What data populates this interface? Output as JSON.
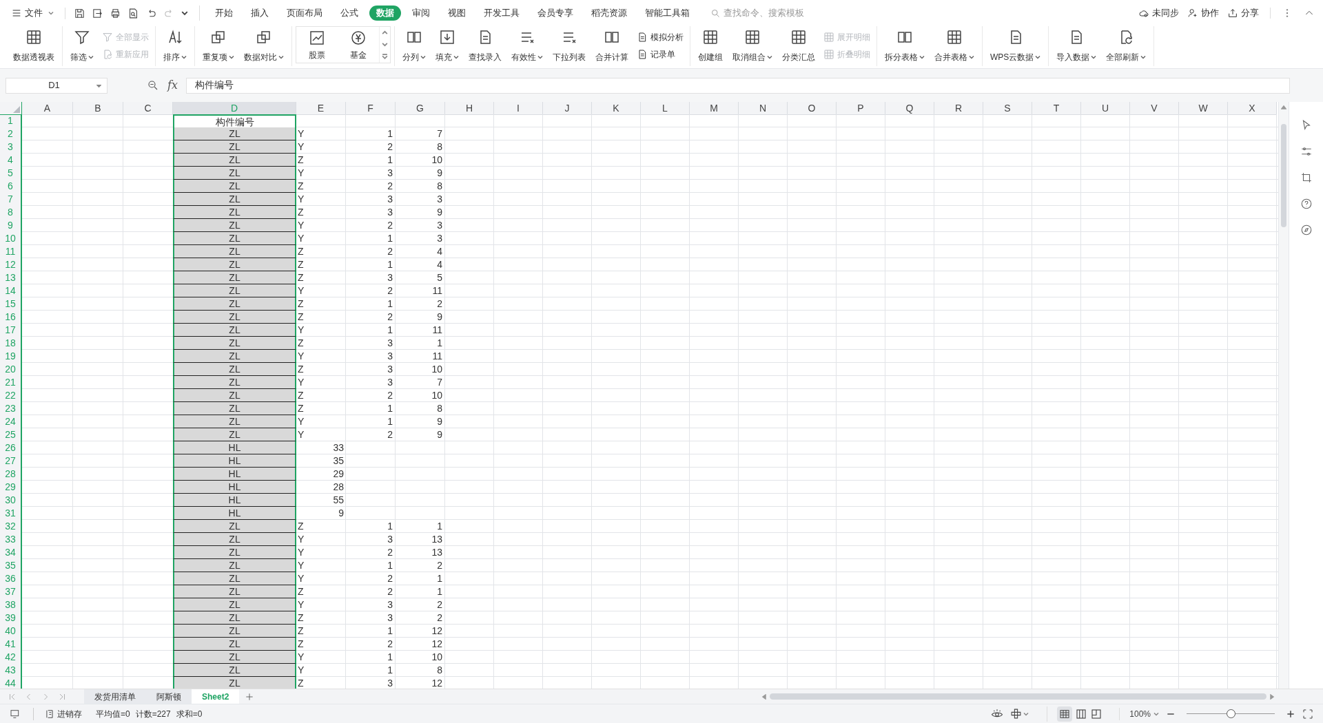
{
  "menu": {
    "label": "文件"
  },
  "tabs": [
    {
      "label": "开始",
      "selected": false
    },
    {
      "label": "插入",
      "selected": false
    },
    {
      "label": "页面布局",
      "selected": false
    },
    {
      "label": "公式",
      "selected": false
    },
    {
      "label": "数据",
      "selected": true
    },
    {
      "label": "审阅",
      "selected": false
    },
    {
      "label": "视图",
      "selected": false
    },
    {
      "label": "开发工具",
      "selected": false
    },
    {
      "label": "会员专享",
      "selected": false
    },
    {
      "label": "稻壳资源",
      "selected": false
    },
    {
      "label": "智能工具箱",
      "selected": false
    }
  ],
  "search": {
    "placeholder": "查找命令、搜索模板"
  },
  "top_actions": [
    "未同步",
    "协作",
    "分享"
  ],
  "ribbon": [
    [
      {
        "kind": "large",
        "label": "数据透视表",
        "dropdown": false,
        "disabled": false
      }
    ],
    [
      {
        "kind": "large",
        "label": "筛选",
        "dropdown": true,
        "disabled": false
      },
      {
        "kind": "stack",
        "items": [
          {
            "label": "全部显示",
            "disabled": true
          },
          {
            "label": "重新应用",
            "disabled": true
          }
        ]
      }
    ],
    [
      {
        "kind": "large",
        "label": "排序",
        "dropdown": true,
        "disabled": false
      }
    ],
    [
      {
        "kind": "large",
        "label": "重复项",
        "dropdown": true,
        "disabled": false
      },
      {
        "kind": "large",
        "label": "数据对比",
        "dropdown": true,
        "disabled": false
      }
    ],
    [
      {
        "kind": "gallery",
        "items": [
          {
            "label": "股票"
          },
          {
            "label": "基金"
          }
        ]
      }
    ],
    [
      {
        "kind": "large",
        "label": "分列",
        "dropdown": true,
        "disabled": false
      },
      {
        "kind": "large",
        "label": "填充",
        "dropdown": true,
        "disabled": false
      },
      {
        "kind": "large",
        "label": "查找录入",
        "dropdown": false,
        "disabled": false
      },
      {
        "kind": "large",
        "label": "有效性",
        "dropdown": true,
        "disabled": false
      },
      {
        "kind": "large",
        "label": "下拉列表",
        "dropdown": false,
        "disabled": false
      },
      {
        "kind": "large",
        "label": "合并计算",
        "dropdown": false,
        "disabled": false
      },
      {
        "kind": "stack",
        "items": [
          {
            "label": "模拟分析",
            "disabled": false
          },
          {
            "label": "记录单",
            "disabled": false
          }
        ]
      }
    ],
    [
      {
        "kind": "large",
        "label": "创建组",
        "dropdown": false,
        "disabled": false
      },
      {
        "kind": "large",
        "label": "取消组合",
        "dropdown": true,
        "disabled": false
      },
      {
        "kind": "large",
        "label": "分类汇总",
        "dropdown": false,
        "disabled": false
      },
      {
        "kind": "stack",
        "items": [
          {
            "label": "展开明细",
            "disabled": true
          },
          {
            "label": "折叠明细",
            "disabled": true
          }
        ]
      }
    ],
    [
      {
        "kind": "large",
        "label": "拆分表格",
        "dropdown": true,
        "disabled": false
      },
      {
        "kind": "large",
        "label": "合并表格",
        "dropdown": true,
        "disabled": false
      }
    ],
    [
      {
        "kind": "large",
        "label": "WPS云数据",
        "dropdown": true,
        "disabled": false
      }
    ],
    [
      {
        "kind": "large",
        "label": "导入数据",
        "dropdown": true,
        "disabled": false
      },
      {
        "kind": "large",
        "label": "全部刷新",
        "dropdown": true,
        "disabled": false
      }
    ]
  ],
  "formula_bar": {
    "name_box": "D1",
    "fx_label": "fx",
    "formula": "构件编号"
  },
  "columns": [
    {
      "label": "A",
      "selected": false
    },
    {
      "label": "B",
      "selected": false
    },
    {
      "label": "C",
      "selected": false
    },
    {
      "label": "D",
      "selected": true
    },
    {
      "label": "E",
      "selected": false
    },
    {
      "label": "F",
      "selected": false
    },
    {
      "label": "G",
      "selected": false
    },
    {
      "label": "H",
      "selected": false
    },
    {
      "label": "I",
      "selected": false
    },
    {
      "label": "J",
      "selected": false
    },
    {
      "label": "K",
      "selected": false
    },
    {
      "label": "L",
      "selected": false
    },
    {
      "label": "M",
      "selected": false
    },
    {
      "label": "N",
      "selected": false
    },
    {
      "label": "O",
      "selected": false
    },
    {
      "label": "P",
      "selected": false
    },
    {
      "label": "Q",
      "selected": false
    },
    {
      "label": "R",
      "selected": false
    },
    {
      "label": "S",
      "selected": false
    },
    {
      "label": "T",
      "selected": false
    },
    {
      "label": "U",
      "selected": false
    },
    {
      "label": "V",
      "selected": false
    },
    {
      "label": "W",
      "selected": false
    },
    {
      "label": "X",
      "selected": false
    }
  ],
  "rows": [
    {
      "number": "1",
      "kind": "header",
      "d": "构件编号"
    },
    {
      "number": "2",
      "kind": "code",
      "d": "ZL",
      "e": "Y",
      "f": "1",
      "g": "7"
    },
    {
      "number": "3",
      "kind": "code",
      "d": "ZL",
      "e": "Y",
      "f": "2",
      "g": "8"
    },
    {
      "number": "4",
      "kind": "code",
      "d": "ZL",
      "e": "Z",
      "f": "1",
      "g": "10"
    },
    {
      "number": "5",
      "kind": "code",
      "d": "ZL",
      "e": "Y",
      "f": "3",
      "g": "9"
    },
    {
      "number": "6",
      "kind": "code",
      "d": "ZL",
      "e": "Z",
      "f": "2",
      "g": "8"
    },
    {
      "number": "7",
      "kind": "code",
      "d": "ZL",
      "e": "Y",
      "f": "3",
      "g": "3"
    },
    {
      "number": "8",
      "kind": "code",
      "d": "ZL",
      "e": "Z",
      "f": "3",
      "g": "9"
    },
    {
      "number": "9",
      "kind": "code",
      "d": "ZL",
      "e": "Y",
      "f": "2",
      "g": "3"
    },
    {
      "number": "10",
      "kind": "code",
      "d": "ZL",
      "e": "Y",
      "f": "1",
      "g": "3"
    },
    {
      "number": "11",
      "kind": "code",
      "d": "ZL",
      "e": "Z",
      "f": "2",
      "g": "4"
    },
    {
      "number": "12",
      "kind": "code",
      "d": "ZL",
      "e": "Z",
      "f": "1",
      "g": "4"
    },
    {
      "number": "13",
      "kind": "code",
      "d": "ZL",
      "e": "Z",
      "f": "3",
      "g": "5"
    },
    {
      "number": "14",
      "kind": "code",
      "d": "ZL",
      "e": "Y",
      "f": "2",
      "g": "11"
    },
    {
      "number": "15",
      "kind": "code",
      "d": "ZL",
      "e": "Z",
      "f": "1",
      "g": "2"
    },
    {
      "number": "16",
      "kind": "code",
      "d": "ZL",
      "e": "Z",
      "f": "2",
      "g": "9"
    },
    {
      "number": "17",
      "kind": "code",
      "d": "ZL",
      "e": "Y",
      "f": "1",
      "g": "11"
    },
    {
      "number": "18",
      "kind": "code",
      "d": "ZL",
      "e": "Z",
      "f": "3",
      "g": "1"
    },
    {
      "number": "19",
      "kind": "code",
      "d": "ZL",
      "e": "Y",
      "f": "3",
      "g": "11"
    },
    {
      "number": "20",
      "kind": "code",
      "d": "ZL",
      "e": "Z",
      "f": "3",
      "g": "10"
    },
    {
      "number": "21",
      "kind": "code",
      "d": "ZL",
      "e": "Y",
      "f": "3",
      "g": "7"
    },
    {
      "number": "22",
      "kind": "code",
      "d": "ZL",
      "e": "Z",
      "f": "2",
      "g": "10"
    },
    {
      "number": "23",
      "kind": "code",
      "d": "ZL",
      "e": "Z",
      "f": "1",
      "g": "8"
    },
    {
      "number": "24",
      "kind": "code",
      "d": "ZL",
      "e": "Y",
      "f": "1",
      "g": "9"
    },
    {
      "number": "25",
      "kind": "code",
      "d": "ZL",
      "e": "Y",
      "f": "2",
      "g": "9"
    },
    {
      "number": "26",
      "kind": "quantity",
      "d": "HL",
      "e": "33"
    },
    {
      "number": "27",
      "kind": "quantity",
      "d": "HL",
      "e": "35"
    },
    {
      "number": "28",
      "kind": "quantity",
      "d": "HL",
      "e": "29"
    },
    {
      "number": "29",
      "kind": "quantity",
      "d": "HL",
      "e": "28"
    },
    {
      "number": "30",
      "kind": "quantity",
      "d": "HL",
      "e": "55"
    },
    {
      "number": "31",
      "kind": "quantity",
      "d": "HL",
      "e": "9"
    },
    {
      "number": "32",
      "kind": "code",
      "d": "ZL",
      "e": "Z",
      "f": "1",
      "g": "1"
    },
    {
      "number": "33",
      "kind": "code",
      "d": "ZL",
      "e": "Y",
      "f": "3",
      "g": "13"
    },
    {
      "number": "34",
      "kind": "code",
      "d": "ZL",
      "e": "Y",
      "f": "2",
      "g": "13"
    },
    {
      "number": "35",
      "kind": "code",
      "d": "ZL",
      "e": "Y",
      "f": "1",
      "g": "2"
    },
    {
      "number": "36",
      "kind": "code",
      "d": "ZL",
      "e": "Y",
      "f": "2",
      "g": "1"
    },
    {
      "number": "37",
      "kind": "code",
      "d": "ZL",
      "e": "Z",
      "f": "2",
      "g": "1"
    },
    {
      "number": "38",
      "kind": "code",
      "d": "ZL",
      "e": "Y",
      "f": "3",
      "g": "2"
    },
    {
      "number": "39",
      "kind": "code",
      "d": "ZL",
      "e": "Z",
      "f": "3",
      "g": "2"
    },
    {
      "number": "40",
      "kind": "code",
      "d": "ZL",
      "e": "Z",
      "f": "1",
      "g": "12"
    },
    {
      "number": "41",
      "kind": "code",
      "d": "ZL",
      "e": "Z",
      "f": "2",
      "g": "12"
    },
    {
      "number": "42",
      "kind": "code",
      "d": "ZL",
      "e": "Y",
      "f": "1",
      "g": "10"
    },
    {
      "number": "43",
      "kind": "code",
      "d": "ZL",
      "e": "Y",
      "f": "1",
      "g": "8"
    },
    {
      "number": "44",
      "kind": "code",
      "d": "ZL",
      "e": "Z",
      "f": "3",
      "g": "12"
    }
  ],
  "sheets": [
    {
      "label": "发货用清单",
      "selected": false
    },
    {
      "label": "阿斯顿",
      "selected": false
    },
    {
      "label": "Sheet2",
      "selected": true
    }
  ],
  "status_bar": {
    "app": "进销存",
    "stats": [
      "平均值=0",
      "计数=227",
      "求和=0"
    ],
    "zoom": "100%",
    "zoom_slider": {
      "level": 0.5
    }
  }
}
